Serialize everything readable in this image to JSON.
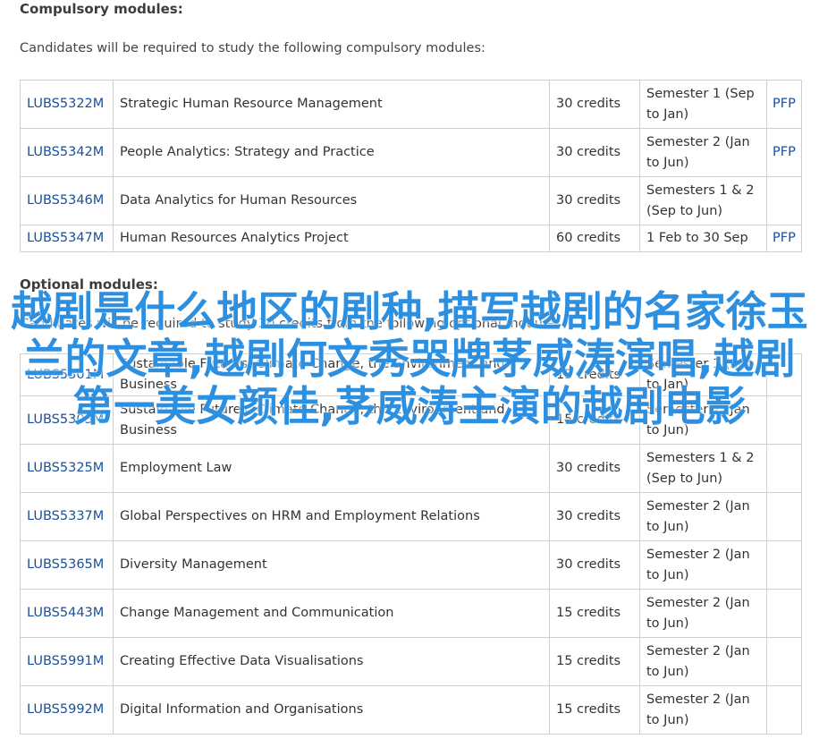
{
  "compulsory": {
    "heading": "Compulsory modules:",
    "intro": "Candidates will be required to study the following compulsory modules:",
    "rows": [
      {
        "code": "LUBS5322M",
        "title": "Strategic Human Resource Management",
        "credits": "30 credits",
        "semester": "Semester 1 (Sep to Jan)",
        "pfp": "PFP"
      },
      {
        "code": "LUBS5342M",
        "title": "People Analytics: Strategy and Practice",
        "credits": "30 credits",
        "semester": "Semester 2 (Jan to Jun)",
        "pfp": "PFP"
      },
      {
        "code": "LUBS5346M",
        "title": "Data Analytics for Human Resources",
        "credits": "30 credits",
        "semester": "Semesters 1 & 2 (Sep to Jun)",
        "pfp": ""
      },
      {
        "code": "LUBS5347M",
        "title": "Human Resources Analytics Project",
        "credits": "60 credits",
        "semester": "1 Feb to 30 Sep",
        "pfp": "PFP"
      }
    ]
  },
  "optional": {
    "heading": "Optional modules:",
    "intro": "Candidates will be required to study 30 credits from the following optional modules",
    "rows": [
      {
        "code": "LUBS5301M",
        "title": "Sustainable Futures: Climate Change, the Environment and Business",
        "credits": "15 credits",
        "semester": "Semester 1 (Sep to Jan)",
        "pfp": ""
      },
      {
        "code": "LUBS5303M",
        "title": "Sustainable Futures: Climate Change, the Environment and Business",
        "credits": "15 credits",
        "semester": "Semester 2 (Jan to Jun)",
        "pfp": ""
      },
      {
        "code": "LUBS5325M",
        "title": "Employment Law",
        "credits": "30 credits",
        "semester": "Semesters 1 & 2 (Sep to Jun)",
        "pfp": ""
      },
      {
        "code": "LUBS5337M",
        "title": "Global Perspectives on HRM and Employment Relations",
        "credits": "30 credits",
        "semester": "Semester 2 (Jan to Jun)",
        "pfp": ""
      },
      {
        "code": "LUBS5365M",
        "title": "Diversity Management",
        "credits": "30 credits",
        "semester": "Semester 2 (Jan to Jun)",
        "pfp": ""
      },
      {
        "code": "LUBS5443M",
        "title": "Change Management and Communication",
        "credits": "15 credits",
        "semester": "Semester 2 (Jan to Jun)",
        "pfp": ""
      },
      {
        "code": "LUBS5991M",
        "title": "Creating Effective Data Visualisations",
        "credits": "15 credits",
        "semester": "Semester 2 (Jan to Jun)",
        "pfp": ""
      },
      {
        "code": "LUBS5992M",
        "title": "Digital Information and Organisations",
        "credits": "15 credits",
        "semester": "Semester 2 (Jan to Jun)",
        "pfp": ""
      }
    ]
  },
  "overlay": {
    "text": "越剧是什么地区的剧种,描写越剧的名家徐玉兰的文章,越剧何文秀哭牌茅威涛演唱,越剧第一美女颜佳,茅威涛主演的越剧电影",
    "color": "#2d8fe0"
  },
  "colors": {
    "link": "#1a4f9c",
    "border": "#cfcfcf",
    "text": "#333333"
  }
}
